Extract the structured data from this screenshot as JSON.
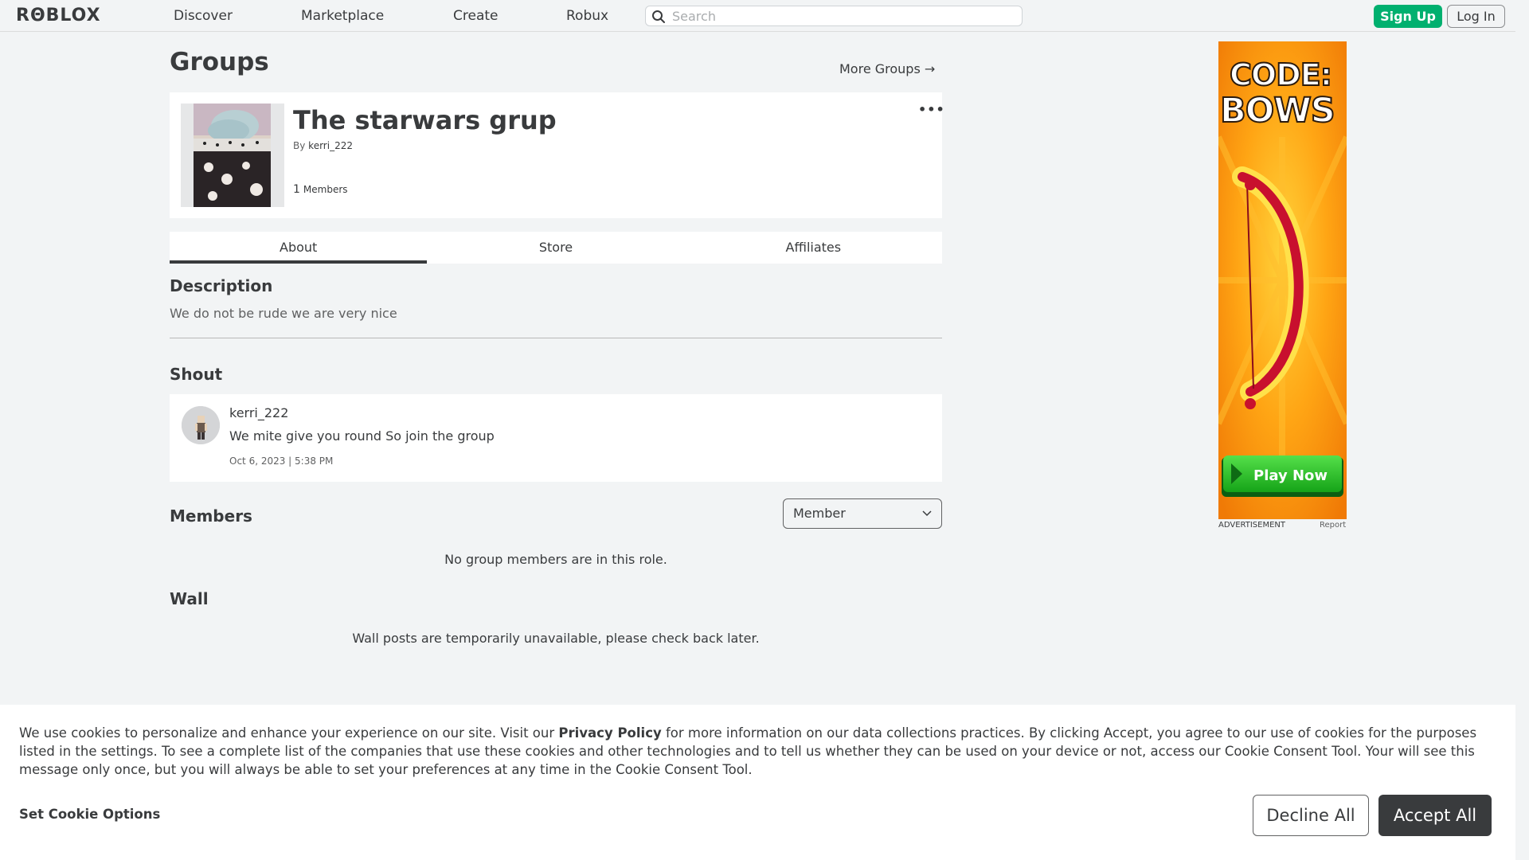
{
  "nav": {
    "logo": "RΘBLOX",
    "links": [
      "Discover",
      "Marketplace",
      "Create",
      "Robux"
    ],
    "search_placeholder": "Search",
    "signup_label": "Sign Up",
    "login_label": "Log In"
  },
  "page": {
    "title": "Groups",
    "more_groups": "More Groups →"
  },
  "group": {
    "name": "The starwars grup",
    "by_prefix": "By",
    "owner": "kerri_222",
    "member_count": "1",
    "member_label": "Members",
    "menu": "•••"
  },
  "tabs": [
    "About",
    "Store",
    "Affiliates"
  ],
  "description": {
    "heading": "Description",
    "text": "We do not be rude we are very nice"
  },
  "shout": {
    "heading": "Shout",
    "user": "kerri_222",
    "body": "We mite give you round So join the group",
    "date": "Oct 6, 2023 | 5:38 PM"
  },
  "members": {
    "heading": "Members",
    "role": "Member",
    "empty": "No group members are in this role."
  },
  "wall": {
    "heading": "Wall",
    "empty": "Wall posts are temporarily unavailable, please check back later."
  },
  "ad": {
    "headline_1": "CODE:",
    "headline_2": "BOWS",
    "cta": "Play Now",
    "label": "ADVERTISEMENT",
    "report": "Report"
  },
  "cookie": {
    "text_1": "We use cookies to personalize and enhance your experience on our site. Visit our",
    "privacy_link": "Privacy Policy",
    "text_2": "for more information on our data collections practices. By clicking Accept, you agree to our use of cookies for the purposes listed in the settings. To see a complete list of the companies that use these cookies and other technologies and to tell us whether they can be used on your device or not, access our Cookie Consent Tool. Your will see this message only once, but you will always be able to set your preferences at any time in the Cookie Consent Tool.",
    "set_options": "Set Cookie Options",
    "decline": "Decline All",
    "accept": "Accept All"
  },
  "colors": {
    "accent_green": "#00b06f",
    "text_dark": "#393b3d",
    "background": "#f2f4f5",
    "ad_orange": "#f59a10"
  }
}
